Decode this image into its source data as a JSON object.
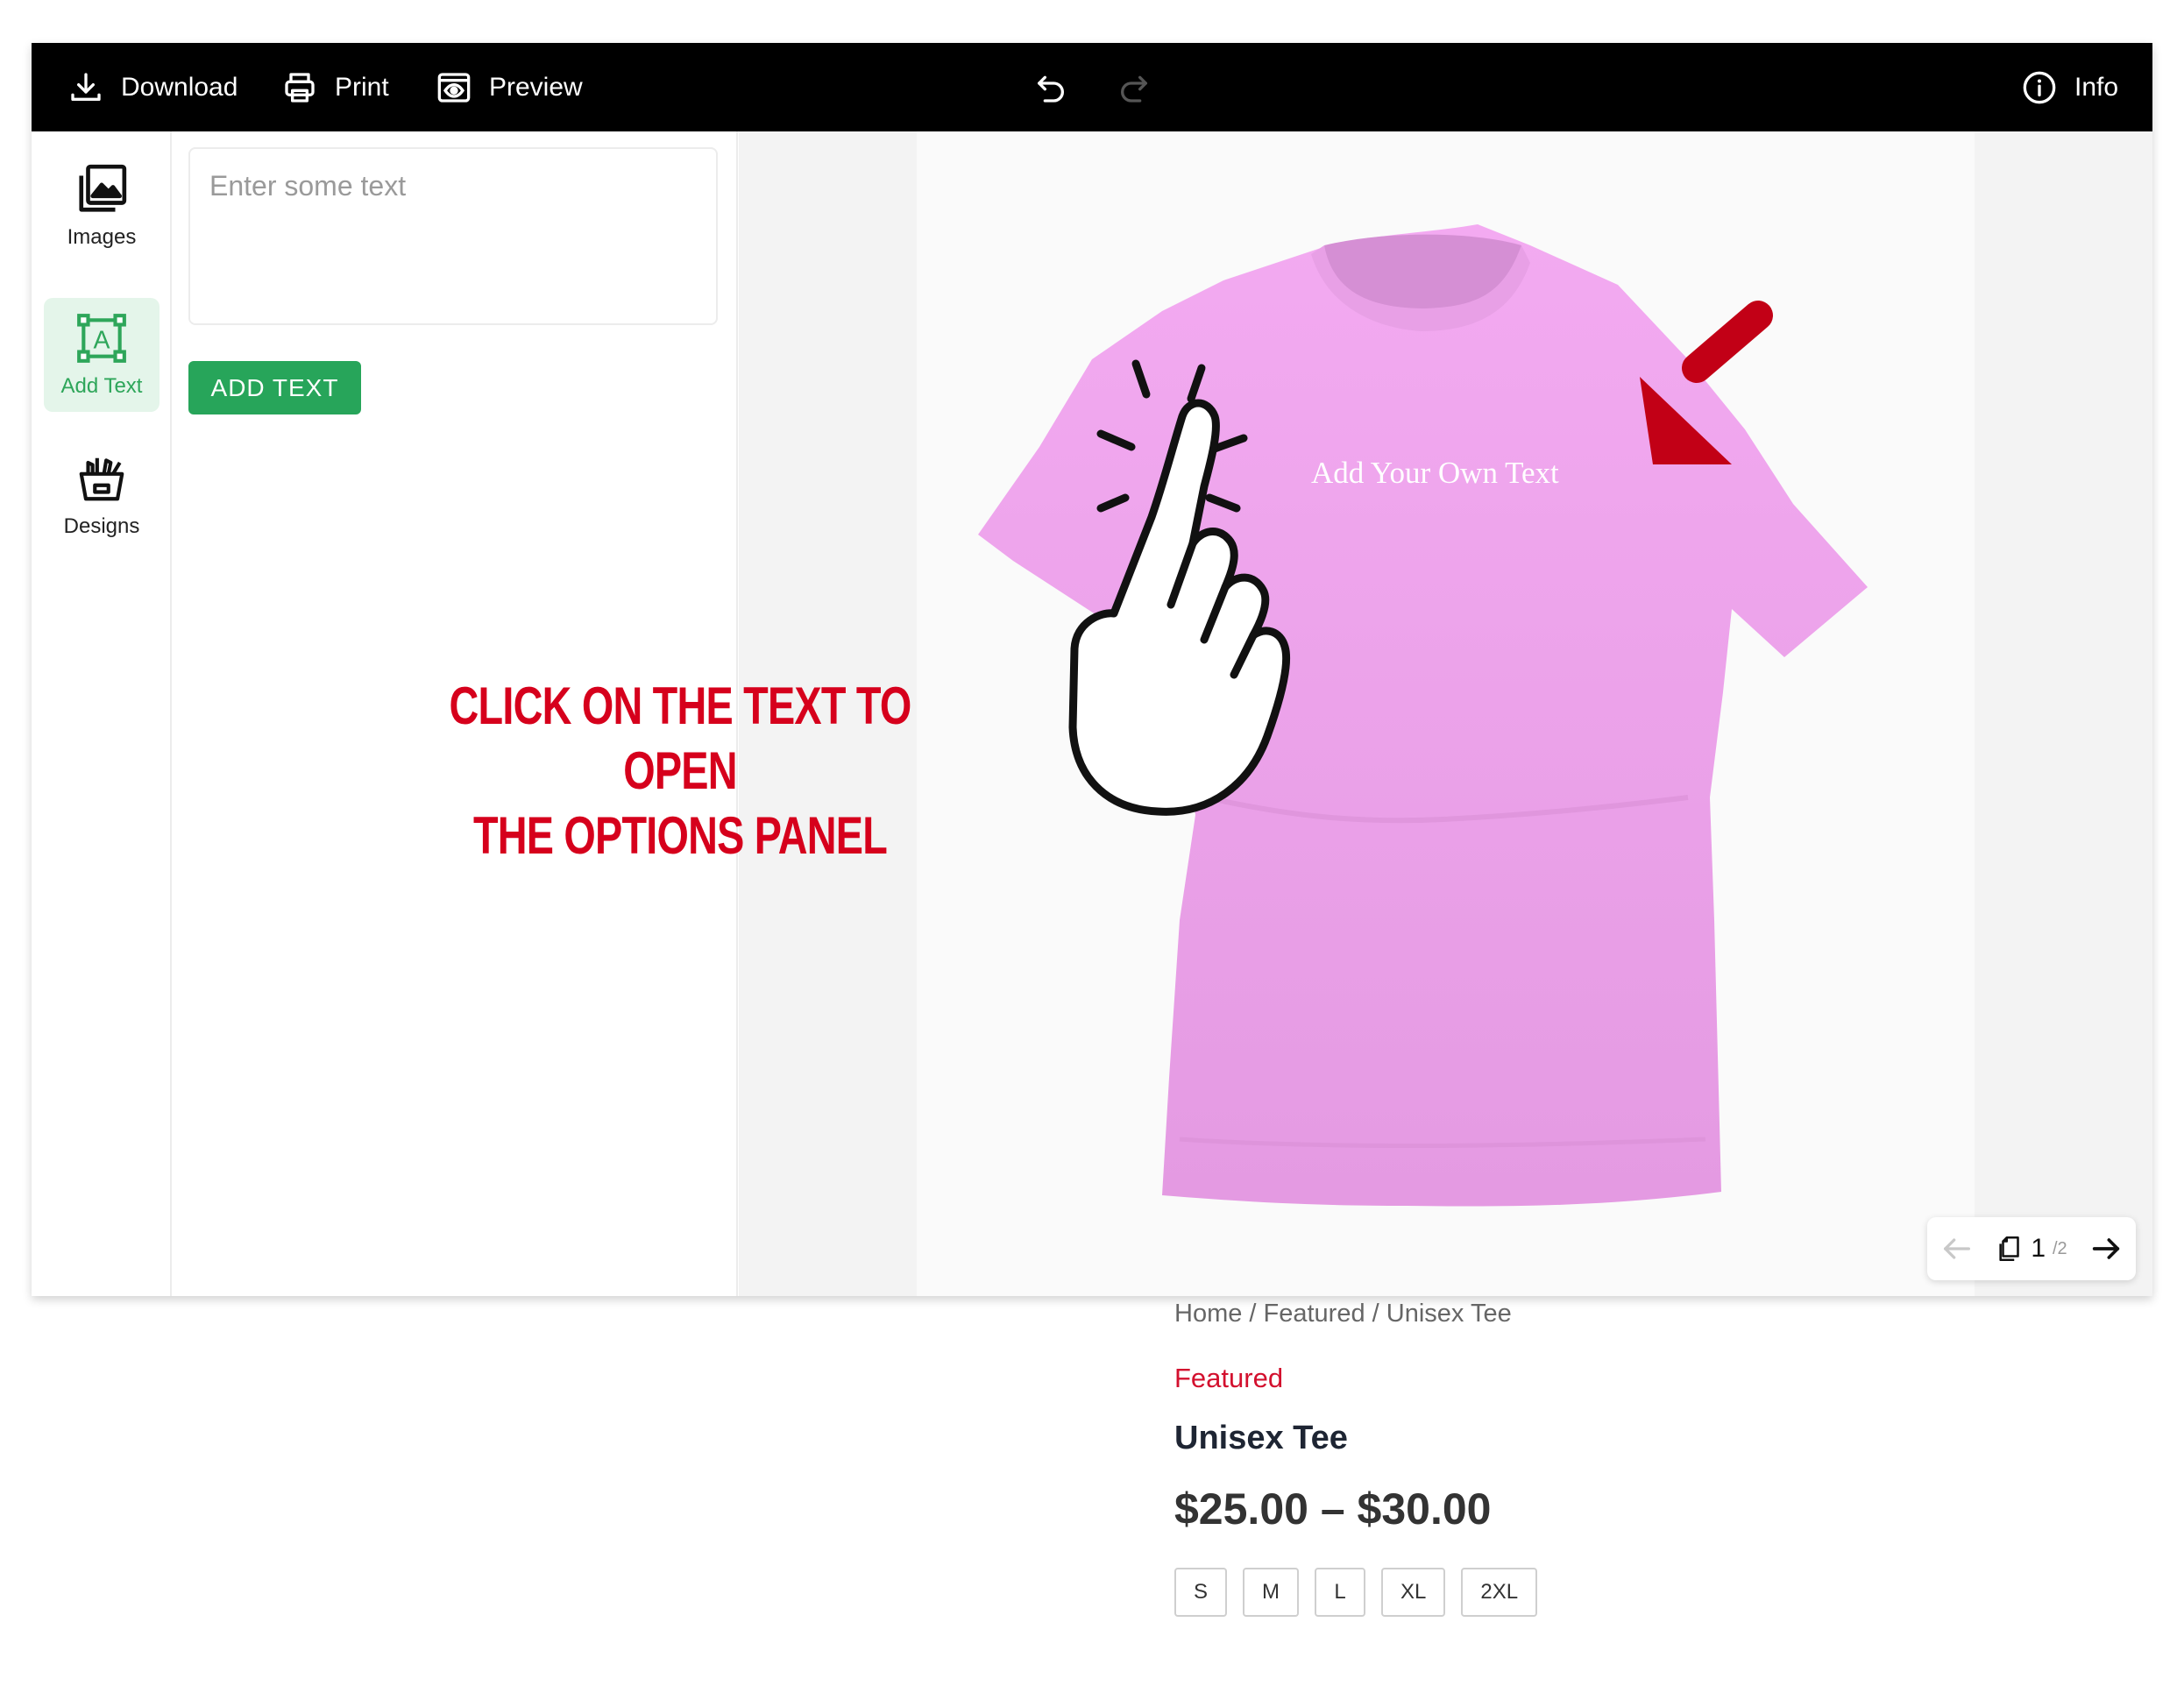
{
  "toolbar": {
    "download_label": "Download",
    "print_label": "Print",
    "preview_label": "Preview",
    "info_label": "Info"
  },
  "sidebar": {
    "items": [
      {
        "label": "Images",
        "icon": "images-icon"
      },
      {
        "label": "Add Text",
        "icon": "text-box-icon",
        "active": true
      },
      {
        "label": "Designs",
        "icon": "designs-icon"
      }
    ]
  },
  "text_panel": {
    "placeholder": "Enter some text",
    "button_label": "ADD TEXT"
  },
  "annotation": {
    "line1": "CLICK ON THE TEXT TO OPEN",
    "line2": "THE OPTIONS PANEL"
  },
  "canvas": {
    "shirt_color": "#f2a6f0",
    "text_object": "Add Your Own Text"
  },
  "pager": {
    "current": "1",
    "total": "/2"
  },
  "product": {
    "breadcrumb": "Home / Featured / Unisex Tee",
    "category": "Featured",
    "title": "Unisex Tee",
    "price": "$25.00 – $30.00",
    "sizes": [
      "S",
      "M",
      "L",
      "XL",
      "2XL"
    ]
  },
  "colors": {
    "accent_green": "#27a55a",
    "annotation_red": "#d6001c",
    "category_red": "#d3102e"
  }
}
